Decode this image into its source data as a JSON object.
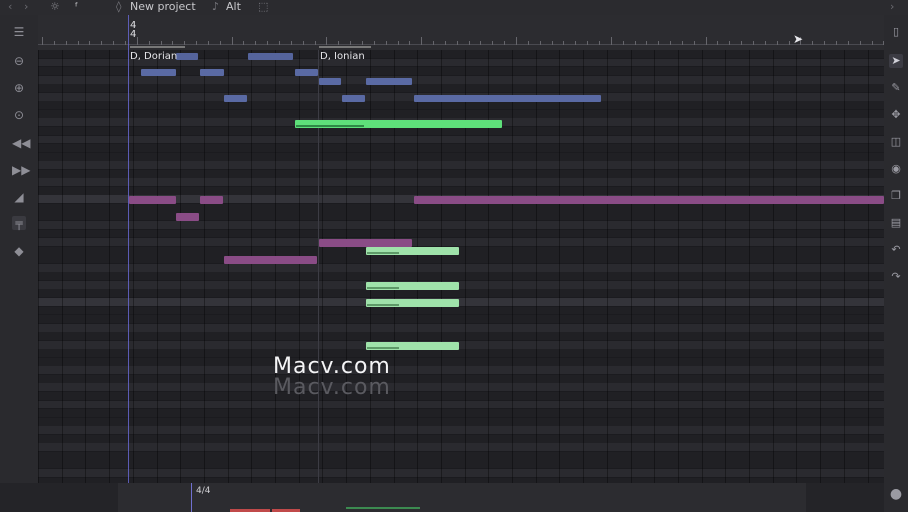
{
  "topbar": {
    "project_icon": "file-icon",
    "project_label": "New project",
    "alt_icon": "music-note-icon",
    "alt_label": "Alt"
  },
  "ruler": {
    "time_sig_top": "4",
    "time_sig_bottom": "4",
    "scale_markers": [
      "D, Dorian",
      "D, Ionian"
    ]
  },
  "bottom": {
    "time_signature": "4/4"
  },
  "watermark": {
    "primary": "Macv.com",
    "shadow": "Macv.com"
  },
  "colors": {
    "note_blue": "#5a6aa4",
    "note_purple": "#8a4c86",
    "note_green_bright": "#5ee07a",
    "note_green_light": "#9fe2aa",
    "grid_dark": "#1d1d21",
    "grid_light": "#2a2a2e"
  },
  "left_toolbar": [
    "panel-icon",
    "zoom-out-icon",
    "zoom-in-icon",
    "zoom-fit-icon",
    "rewind-icon",
    "fast-forward-icon",
    "velocity-ramp-icon",
    "paint-roller-icon",
    "tag-icon"
  ],
  "right_toolbar": [
    "pointer-icon",
    "pencil-icon",
    "move-icon",
    "split-icon",
    "settings-circle-icon",
    "copy-icon",
    "paste-icon",
    "undo-icon",
    "redo-icon",
    "record-icon"
  ]
}
